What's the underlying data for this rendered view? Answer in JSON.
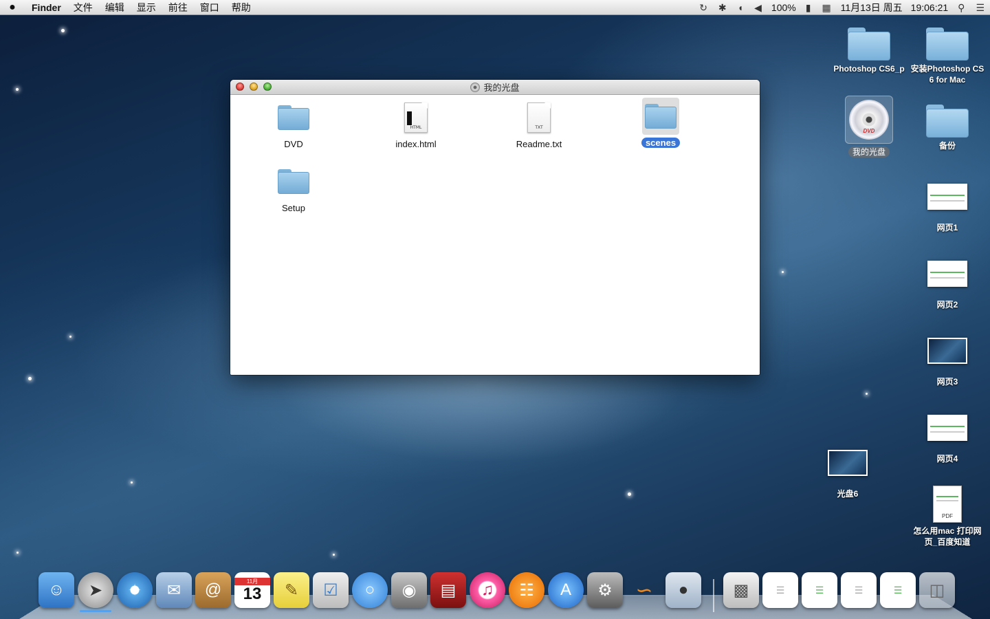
{
  "menubar": {
    "app_name": "Finder",
    "menus": [
      "文件",
      "编辑",
      "显示",
      "前往",
      "窗口",
      "帮助"
    ],
    "battery": "100%",
    "date": "11月13日 周五",
    "time": "19:06:21"
  },
  "window": {
    "title": "我的光盘",
    "items": [
      {
        "name": "DVD",
        "kind": "folder"
      },
      {
        "name": "index.html",
        "kind": "html",
        "tag": "HTML"
      },
      {
        "name": "Readme.txt",
        "kind": "txt",
        "tag": "TXT"
      },
      {
        "name": "scenes",
        "kind": "folder",
        "selected": true
      },
      {
        "name": "Setup",
        "kind": "folder"
      }
    ]
  },
  "desktop": {
    "icons": [
      {
        "label": "Photoshop CS6_p"
      },
      {
        "label": "安装Photoshop CS 6 for Mac"
      },
      {
        "label": "我的光盘",
        "disc_text": "DVD"
      },
      {
        "label": "备份"
      },
      {
        "label": "网页1"
      },
      {
        "label": "网页2"
      },
      {
        "label": "网页3"
      },
      {
        "label": "网页4"
      },
      {
        "label": "光盘6"
      },
      {
        "label": "怎么用mac 打印网页_百度知道",
        "tag": "PDF"
      }
    ]
  },
  "dock": {
    "calendar_day": "13",
    "calendar_month": "11月"
  }
}
